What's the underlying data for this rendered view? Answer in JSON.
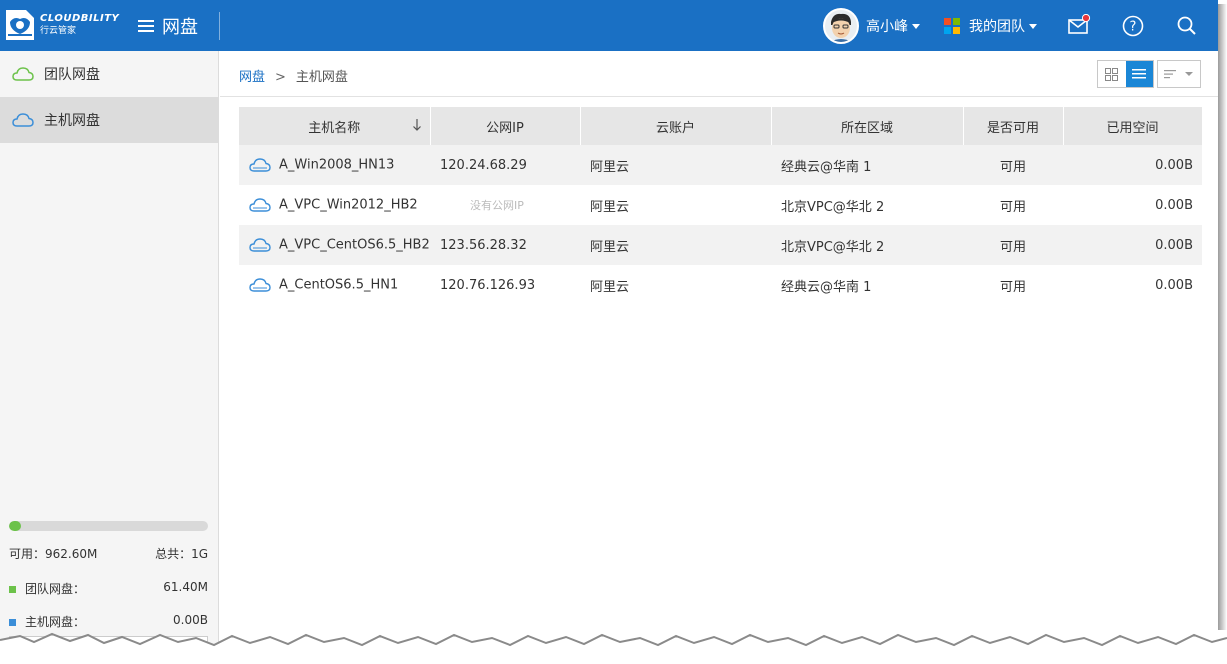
{
  "header": {
    "brand_name": "CLOUDBILITY",
    "brand_sub": "行云管家",
    "section_title": "网盘",
    "user_name": "高小峰",
    "team_label": "我的团队",
    "colors": {
      "bar": "#1a70c4",
      "notify_dot": "#e8363b"
    }
  },
  "sidebar": {
    "items": [
      {
        "label": "团队网盘",
        "icon": "cloud-icon",
        "active": false
      },
      {
        "label": "主机网盘",
        "icon": "cloud-icon",
        "active": true
      }
    ],
    "storage": {
      "used_fraction": 0.06,
      "available_label": "可用：962.60M",
      "total_label": "总共：1G",
      "team_label": "团队网盘：",
      "team_value": "61.40M",
      "host_label": "主机网盘：",
      "host_value": "0.00B",
      "team_color": "#6cc24a",
      "host_color": "#3b8ed8"
    }
  },
  "breadcrumb": {
    "root": "网盘",
    "separator": ">",
    "current": "主机网盘"
  },
  "table": {
    "columns": [
      "主机名称",
      "公网IP",
      "云账户",
      "所在区域",
      "是否可用",
      "已用空间"
    ],
    "rows": [
      {
        "name": "A_Win2008_HN13",
        "ip": "120.24.68.29",
        "account": "阿里云",
        "region": "经典云@华南 1",
        "available": "可用",
        "used": "0.00B"
      },
      {
        "name": "A_VPC_Win2012_HB2",
        "ip": "没有公网IP",
        "account": "阿里云",
        "region": "北京VPC@华北 2",
        "available": "可用",
        "used": "0.00B"
      },
      {
        "name": "A_VPC_CentOS6.5_HB2",
        "ip": "123.56.28.32",
        "account": "阿里云",
        "region": "北京VPC@华北 2",
        "available": "可用",
        "used": "0.00B"
      },
      {
        "name": "A_CentOS6.5_HN1",
        "ip": "120.76.126.93",
        "account": "阿里云",
        "region": "经典云@华南 1",
        "available": "可用",
        "used": "0.00B"
      }
    ]
  }
}
